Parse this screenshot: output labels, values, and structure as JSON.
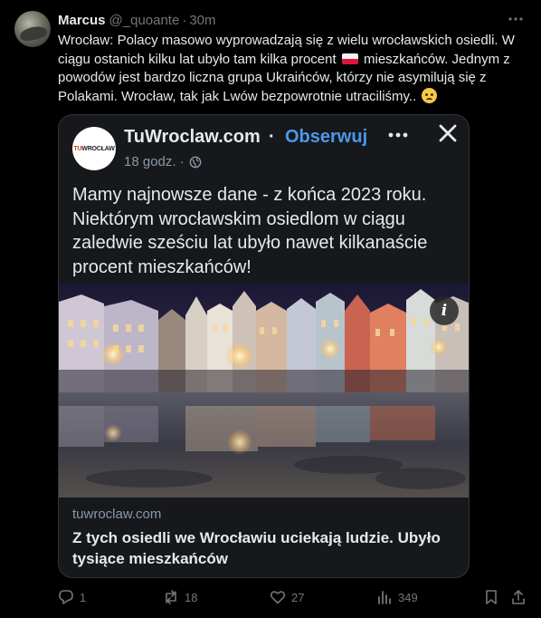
{
  "author": {
    "name": "Marcus",
    "handle": "@_quoante",
    "separator": "·",
    "time": "30m"
  },
  "tweet": {
    "text_part1": "Wrocław: Polacy masowo wyprowadzają się z wielu wrocławskich osiedli. W ciągu ostanich kilku lat ubyło tam kilka procent",
    "text_part2": "mieszkańców. Jednym z powodów jest bardzo liczna grupa Ukraińców, którzy nie asymilują się z Polakami. Wrocław, tak jak Lwów bezpowrotnie utraciliśmy..",
    "flag_icon": "poland-flag-emoji",
    "emoji_icon": "crying-face-emoji"
  },
  "embed": {
    "source_name": "TuWroclaw.com",
    "source_logo_text": "TU",
    "source_logo_accent": "WROCŁAW",
    "dot": "·",
    "follow_label": "Obserwuj",
    "time": "18 godz. ·",
    "post_text": "Mamy najnowsze dane - z końca 2023 roku. Niektórym wrocławskim osiedlom w ciągu zaledwie sześciu lat ubyło nawet kilkanaście procent mieszkańców!",
    "info_label": "i",
    "link_domain": "tuwroclaw.com",
    "link_title": "Z tych osiedli we Wrocławiu uciekają ludzie. Ubyło tysiące mieszkańców"
  },
  "actions": {
    "replies": "1",
    "reposts": "18",
    "likes": "27",
    "views": "349"
  },
  "colors": {
    "background": "#000000",
    "card": "#16181c",
    "follow": "#4a99e9",
    "muted": "#71767b"
  }
}
